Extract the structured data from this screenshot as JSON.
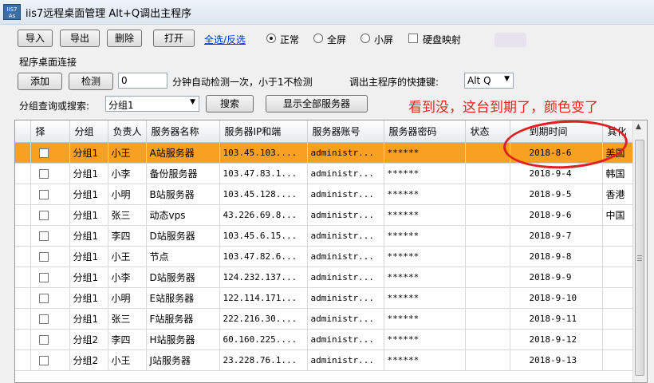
{
  "window": {
    "icon_text": "IIS7 As",
    "title": "iis7远程桌面管理 Alt+Q调出主程序"
  },
  "toolbar": {
    "import_label": "导入",
    "export_label": "导出",
    "delete_label": "删除",
    "open_label": "打开",
    "select_all_label": "全选/反选",
    "mode_options": [
      "正常",
      "全屏",
      "小屏"
    ],
    "mode_selected": "正常",
    "disk_map_label": "硬盘映射"
  },
  "section": {
    "title": "程序桌面连接",
    "add_label": "添加",
    "check_label": "检测",
    "interval_value": "0",
    "interval_text": "分钟自动检测一次，小于1不检测",
    "hotkey_label": "调出主程序的快捷键:",
    "hotkey_value": "Alt Q"
  },
  "filter": {
    "label": "分组查询或搜索:",
    "group_value": "分组1",
    "search_label": "搜索",
    "show_all_label": "显示全部服务器"
  },
  "annotation": "看到没，这台到期了，颜色变了",
  "table": {
    "headers": [
      "选择",
      "分组",
      "负责人",
      "服务器名称",
      "服务器IP和端",
      "服务器账号",
      "服务器密码",
      "状态",
      "到期时间",
      "其他"
    ],
    "header_display": [
      "择",
      "分组",
      "负责人",
      "服务器名称",
      "服务器IP和端",
      "服务器账号",
      "服务器密码",
      "状态",
      "到期时间",
      "其化"
    ],
    "rows": [
      {
        "group": "分组1",
        "owner": "小王",
        "name": "A站服务器",
        "ip": "103.45.103....",
        "account": "administr...",
        "password": "******",
        "status": "",
        "expiry": "2018-8-6",
        "other": "美国",
        "expired": true
      },
      {
        "group": "分组1",
        "owner": "小李",
        "name": "备份服务器",
        "ip": "103.47.83.1...",
        "account": "administr...",
        "password": "******",
        "status": "",
        "expiry": "2018-9-4",
        "other": "韩国",
        "expired": false
      },
      {
        "group": "分组1",
        "owner": "小明",
        "name": "B站服务器",
        "ip": "103.45.128....",
        "account": "administr...",
        "password": "******",
        "status": "",
        "expiry": "2018-9-5",
        "other": "香港",
        "expired": false
      },
      {
        "group": "分组1",
        "owner": "张三",
        "name": "动态vps",
        "ip": "43.226.69.8...",
        "account": "administr...",
        "password": "******",
        "status": "",
        "expiry": "2018-9-6",
        "other": "中国",
        "expired": false
      },
      {
        "group": "分组1",
        "owner": "李四",
        "name": "D站服务器",
        "ip": "103.45.6.15...",
        "account": "administr...",
        "password": "******",
        "status": "",
        "expiry": "2018-9-7",
        "other": "",
        "expired": false
      },
      {
        "group": "分组1",
        "owner": "小王",
        "name": "节点",
        "ip": "103.47.82.6...",
        "account": "administr...",
        "password": "******",
        "status": "",
        "expiry": "2018-9-8",
        "other": "",
        "expired": false
      },
      {
        "group": "分组1",
        "owner": "小李",
        "name": "D站服务器",
        "ip": "124.232.137...",
        "account": "administr...",
        "password": "******",
        "status": "",
        "expiry": "2018-9-9",
        "other": "",
        "expired": false
      },
      {
        "group": "分组1",
        "owner": "小明",
        "name": "E站服务器",
        "ip": "122.114.171...",
        "account": "administr...",
        "password": "******",
        "status": "",
        "expiry": "2018-9-10",
        "other": "",
        "expired": false
      },
      {
        "group": "分组1",
        "owner": "张三",
        "name": "F站服务器",
        "ip": "222.216.30....",
        "account": "administr...",
        "password": "******",
        "status": "",
        "expiry": "2018-9-11",
        "other": "",
        "expired": false
      },
      {
        "group": "分组2",
        "owner": "李四",
        "name": "H站服务器",
        "ip": "60.160.225....",
        "account": "administr...",
        "password": "******",
        "status": "",
        "expiry": "2018-9-12",
        "other": "",
        "expired": false
      },
      {
        "group": "分组2",
        "owner": "小王",
        "name": "J站服务器",
        "ip": "23.228.76.1...",
        "account": "administr...",
        "password": "******",
        "status": "",
        "expiry": "2018-9-13",
        "other": "",
        "expired": false
      }
    ]
  },
  "colors": {
    "expired_row": "#f7a021",
    "annotation": "#e8231e"
  }
}
